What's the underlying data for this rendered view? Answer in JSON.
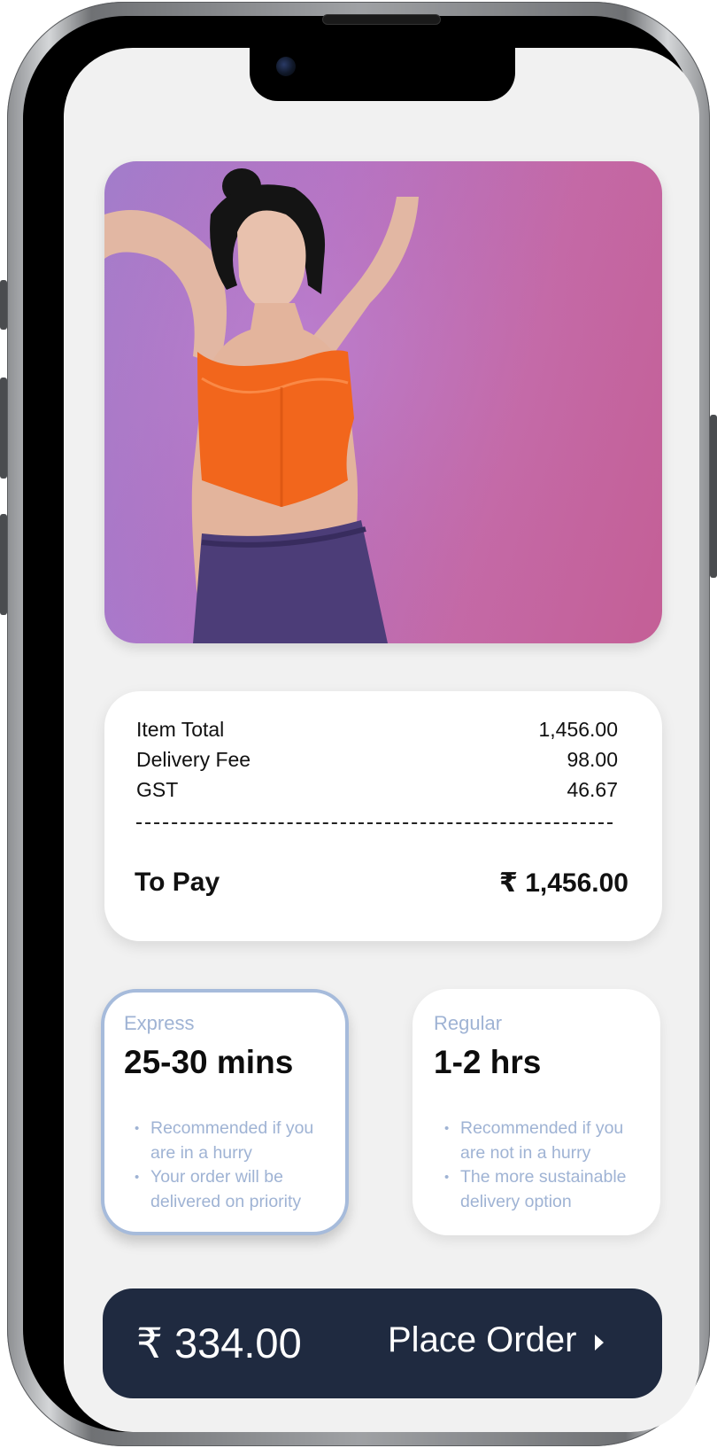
{
  "product": {
    "image_alt": "Model wearing an orange lace corset crop top and purple trousers",
    "background_colors": [
      "#9d7fd0",
      "#c45f96"
    ]
  },
  "bill": {
    "rows": [
      {
        "label": "Item Total",
        "value": "1,456.00"
      },
      {
        "label": "Delivery Fee",
        "value": "98.00"
      },
      {
        "label": "GST",
        "value": "46.67"
      }
    ],
    "to_pay_label": "To Pay",
    "to_pay_value": "₹ 1,456.00"
  },
  "delivery_options": [
    {
      "type": "Express",
      "time": "25-30 mins",
      "selected": true,
      "points": [
        "Recommended if you are in a hurry",
        "Your order will be delivered on priority"
      ]
    },
    {
      "type": "Regular",
      "time": "1-2 hrs",
      "selected": false,
      "points": [
        "Recommended if you are not in a hurry",
        "The more sustainable delivery option"
      ]
    }
  ],
  "order_bar": {
    "amount": "₹ 334.00",
    "label": "Place Order",
    "arrow_icon": "caret-right-icon"
  },
  "colors": {
    "accent_border": "#a6bbdb",
    "muted_text": "#9fb3d4",
    "order_bar_bg": "#1f2a40",
    "screen_bg": "#f1f1f1"
  }
}
